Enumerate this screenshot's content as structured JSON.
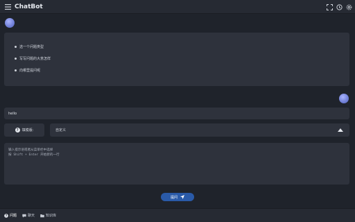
{
  "app": {
    "title": "ChatBot",
    "menu_icon": "hamburger-icon",
    "toolbar_icons": [
      "fullscreen-icon",
      "history-icon",
      "settings-icon"
    ]
  },
  "conversation": {
    "bot_suggestions": [
      "选一个问题类型",
      "写写问题的大意怎样",
      "向哪里提问呢"
    ],
    "user_message": "hello"
  },
  "composer": {
    "role_button_label": "填模版:",
    "role_select_value": "自定义",
    "input_placeholder_line1": "输入提示语或者从菜单栏中选择",
    "input_placeholder_line2": "按 Shift + Enter 开始新的一行",
    "send_label": "提问"
  },
  "bottom_tabs": [
    {
      "label": "问题",
      "icon": "question-icon",
      "active": true
    },
    {
      "label": "聊天",
      "icon": "chat-icon",
      "active": false
    },
    {
      "label": "知识库",
      "icon": "folder-icon",
      "active": false
    }
  ],
  "colors": {
    "background": "#1f232b",
    "surface": "#2e323c",
    "accent": "#2a5aa8"
  }
}
